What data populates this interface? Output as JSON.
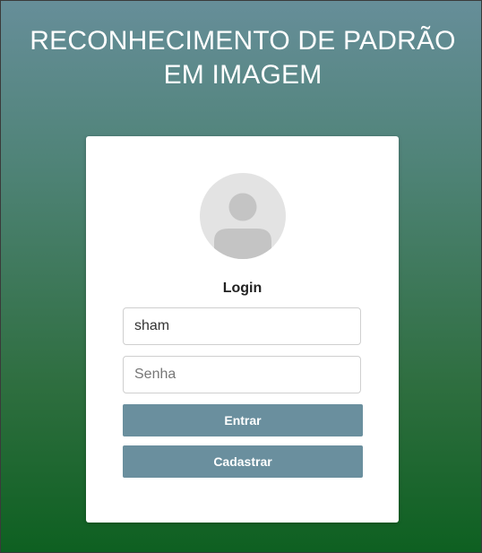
{
  "header": {
    "title_line1": "RECONHECIMENTO DE PADRÃO",
    "title_line2": "EM IMAGEM"
  },
  "login_card": {
    "avatar_icon": "user-avatar-icon",
    "heading": "Login",
    "username": {
      "value": "sham"
    },
    "password": {
      "placeholder": "Senha",
      "value": ""
    },
    "enter_button_label": "Entrar",
    "register_button_label": "Cadastrar"
  },
  "colors": {
    "gradient_top": "#668e99",
    "gradient_bottom": "#0e6021",
    "button_bg": "#6a8f9e",
    "avatar_bg": "#e3e3e3",
    "avatar_fg": "#c4c4c4"
  }
}
